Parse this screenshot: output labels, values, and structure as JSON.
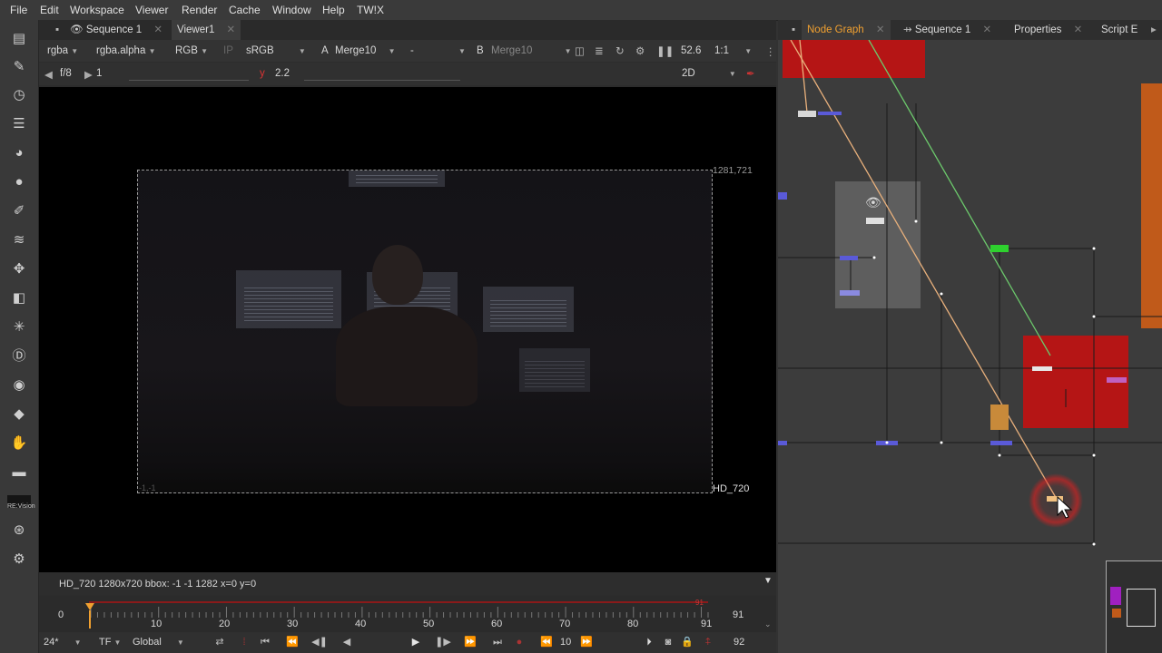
{
  "menu": [
    "File",
    "Edit",
    "Workspace",
    "Viewer",
    "Render",
    "Cache",
    "Window",
    "Help",
    "TW!X"
  ],
  "viewer": {
    "tabs": [
      {
        "label": "Sequence 1",
        "icon": "eye-icon"
      },
      {
        "label": "Viewer1"
      }
    ],
    "channels": "rgba",
    "alpha": "rgba.alpha",
    "colorspace": "RGB",
    "lut": "sRGB",
    "input_a_label": "A",
    "input_a": "Merge10",
    "input_a2": "-",
    "input_b_label": "B",
    "input_b": "Merge10",
    "zoom": "52.6",
    "ratio": "1:1",
    "fstop": "f/8",
    "frame_field": "1",
    "gamma_mark": "y",
    "gamma": "2.2",
    "view_mode": "2D",
    "coord_topright": "1281,721",
    "coord_bottomleft": "-1,-1",
    "format_label": "HD_720",
    "info": "HD_720 1280x720  bbox: -1 -1 1282  x=0 y=0"
  },
  "timeline": {
    "start": "0",
    "end": "91",
    "end_top": "91",
    "ticks": [
      "10",
      "20",
      "30",
      "40",
      "50",
      "60",
      "70",
      "80",
      "91"
    ],
    "fps": "24*",
    "tf": "TF",
    "scope": "Global",
    "step": "10",
    "end_frame": "92",
    "playhead_value": 0
  },
  "nodegraph": {
    "tabs": [
      {
        "label": "Node Graph",
        "active": true
      },
      {
        "label": "Sequence 1"
      },
      {
        "label": "Properties"
      },
      {
        "label": "Script E"
      }
    ]
  },
  "colors": {
    "accent_orange": "#f0a030",
    "node_red": "#b51515",
    "node_green": "#2ed12e",
    "wire_orange": "#e8b07c",
    "wire_green": "#6cc96c",
    "highlight_red": "#e02020"
  }
}
